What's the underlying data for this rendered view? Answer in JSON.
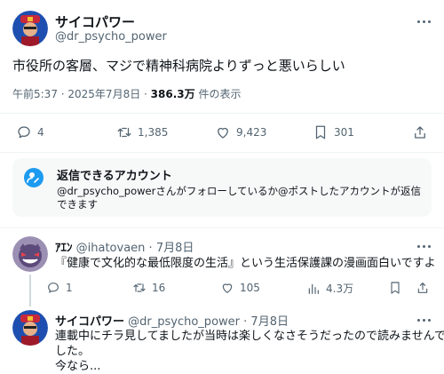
{
  "main_post": {
    "display_name": "サイコパワー",
    "handle": "@dr_psycho_power",
    "text": "市役所の客層、マジで精神科病院よりずっと悪いらしい",
    "time_date": "午前5:37 · 2025年7月8日 · ",
    "views_count": "386.3万",
    "views_suffix": " 件の表示",
    "stats": {
      "replies": "4",
      "reposts": "1,385",
      "likes": "9,423",
      "bookmarks": "301"
    }
  },
  "reply_restriction": {
    "title": "返信できるアカウント",
    "body": "@dr_psycho_powerさんがフォローしているか@ポストしたアカウントが返信できます"
  },
  "reply1": {
    "display_name": "ｱｴﾝ",
    "handle": "@ihatovaen",
    "dot": "·",
    "date": "7月8日",
    "text": "『健康で文化的な最低限度の生活』という生活保護課の漫画面白いですよ",
    "stats": {
      "replies": "1",
      "reposts": "16",
      "likes": "105",
      "views": "4.3万"
    }
  },
  "reply2": {
    "display_name": "サイコパワー",
    "handle": "@dr_psycho_power",
    "dot": "·",
    "date": "7月8日",
    "text_lines": [
      "連載中にチラ見してましたが当時は楽しくなさそうだったので読みませんで",
      "した。",
      "今なら..."
    ]
  },
  "colors": {
    "accent": "#1d9bf0",
    "text": "#0f1419",
    "muted": "#536471",
    "divider": "#eff3f4"
  }
}
